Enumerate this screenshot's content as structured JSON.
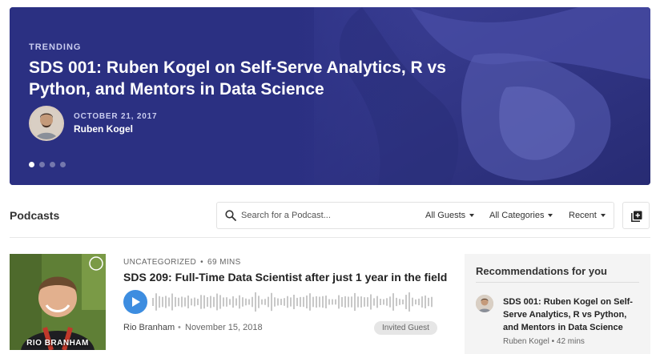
{
  "hero": {
    "kicker": "TRENDING",
    "title": "SDS 001: Ruben Kogel on Self-Serve Analytics, R vs Python, and Mentors in Data Science",
    "date": "OCTOBER 21, 2017",
    "author": "Ruben Kogel",
    "slides_count": 4,
    "active_slide": 1
  },
  "toolbar": {
    "section_title": "Podcasts",
    "search_placeholder": "Search for a Podcast...",
    "search_value": "",
    "filters": {
      "guests": "All Guests",
      "categories": "All Categories",
      "sort": "Recent"
    }
  },
  "episode": {
    "category": "UNCATEGORIZED",
    "separator": "•",
    "duration": "69 MINS",
    "title": "SDS 209: Full-Time Data Scientist after just 1 year in the field",
    "host": "Rio Branham",
    "date": "November 15, 2018",
    "badge": "Invited Guest",
    "thumb_label": "RIO BRANHAM"
  },
  "recommendations": {
    "title": "Recommendations for you",
    "items": [
      {
        "title": "SDS 001: Ruben Kogel on Self-Serve Analytics, R vs Python, and Mentors in Data Science",
        "author": "Ruben Kogel",
        "separator": "•",
        "duration": "42 mins"
      }
    ]
  },
  "colors": {
    "hero_bg": "#2c3184",
    "play_button": "#3d8de0",
    "badge_bg": "#e6e6e6",
    "reco_bg": "#f4f4f4"
  },
  "icons": [
    "search-icon",
    "chevron-down-icon",
    "add-playlist-icon",
    "play-icon"
  ]
}
